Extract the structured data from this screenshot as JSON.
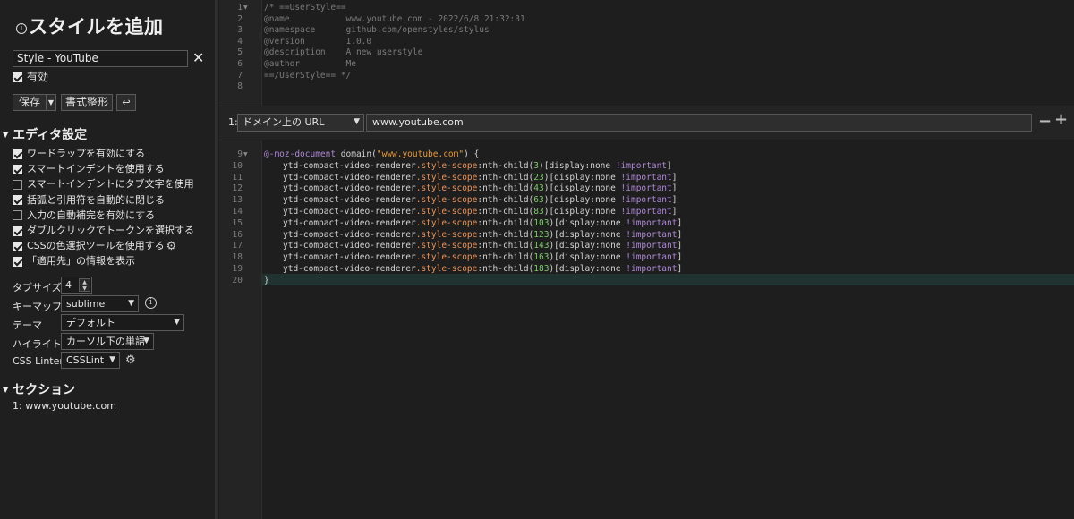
{
  "sidebar": {
    "title": "スタイルを追加",
    "style_name": "Style - YouTube",
    "enabled_label": "有効",
    "save_label": "保存",
    "format_label": "書式整形",
    "wrap_icon": "↩",
    "editor_settings_heading": "エディタ設定",
    "options": [
      {
        "label": "ワードラップを有効にする",
        "checked": true
      },
      {
        "label": "スマートインデントを使用する",
        "checked": true
      },
      {
        "label": "スマートインデントにタブ文字を使用",
        "checked": false
      },
      {
        "label": "括弧と引用符を自動的に閉じる",
        "checked": true
      },
      {
        "label": "入力の自動補完を有効にする",
        "checked": false
      },
      {
        "label": "ダブルクリックでトークンを選択する",
        "checked": true
      },
      {
        "label": "CSSの色選択ツールを使用する",
        "checked": true
      },
      {
        "label": "「適用先」の情報を表示",
        "checked": true
      }
    ],
    "tab_size_label": "タブサイズ",
    "tab_size_value": "4",
    "keymap_label": "キーマップ",
    "keymap_value": "sublime",
    "theme_label": "テーマ",
    "theme_value": "デフォルト",
    "highlight_label": "ハイライト",
    "highlight_value": "カーソル下の単語",
    "linter_label": "CSS Linter",
    "linter_value": "CSSLint",
    "sections_heading": "セクション",
    "section_item": "1: www.youtube.com"
  },
  "editor": {
    "header_lines": [
      {
        "n": "1",
        "text": "/* ==UserStyle=="
      },
      {
        "n": "2",
        "text": "@name           www.youtube.com - 2022/6/8 21:32:31"
      },
      {
        "n": "3",
        "text": "@namespace      github.com/openstyles/stylus"
      },
      {
        "n": "4",
        "text": "@version        1.0.0"
      },
      {
        "n": "5",
        "text": "@description    A new userstyle"
      },
      {
        "n": "6",
        "text": "@author         Me"
      },
      {
        "n": "7",
        "text": "==/UserStyle== */"
      },
      {
        "n": "8",
        "text": ""
      }
    ],
    "section_number": "1:",
    "applies_to_type": "ドメイン上の URL",
    "applies_to_value": "www.youtube.com",
    "doc_line": {
      "n": "9",
      "kw": "@-moz-document",
      "fn": " domain(",
      "str": "\"www.youtube.com\"",
      "end": ") {"
    },
    "rule_selector": "ytd-compact-video-renderer",
    "rule_class": ".style-scope",
    "rule_pseudo": ":nth-child(",
    "rule_tail_open": ")[display:",
    "rule_tail_value": "none",
    "rule_important": " !important",
    "rule_close": "]",
    "rules": [
      {
        "n": "10",
        "num": "3"
      },
      {
        "n": "11",
        "num": "23"
      },
      {
        "n": "12",
        "num": "43"
      },
      {
        "n": "13",
        "num": "63"
      },
      {
        "n": "14",
        "num": "83"
      },
      {
        "n": "15",
        "num": "103"
      },
      {
        "n": "16",
        "num": "123"
      },
      {
        "n": "17",
        "num": "143"
      },
      {
        "n": "18",
        "num": "163"
      },
      {
        "n": "19",
        "num": "183"
      }
    ],
    "last_line": {
      "n": "20",
      "text": "}"
    }
  }
}
